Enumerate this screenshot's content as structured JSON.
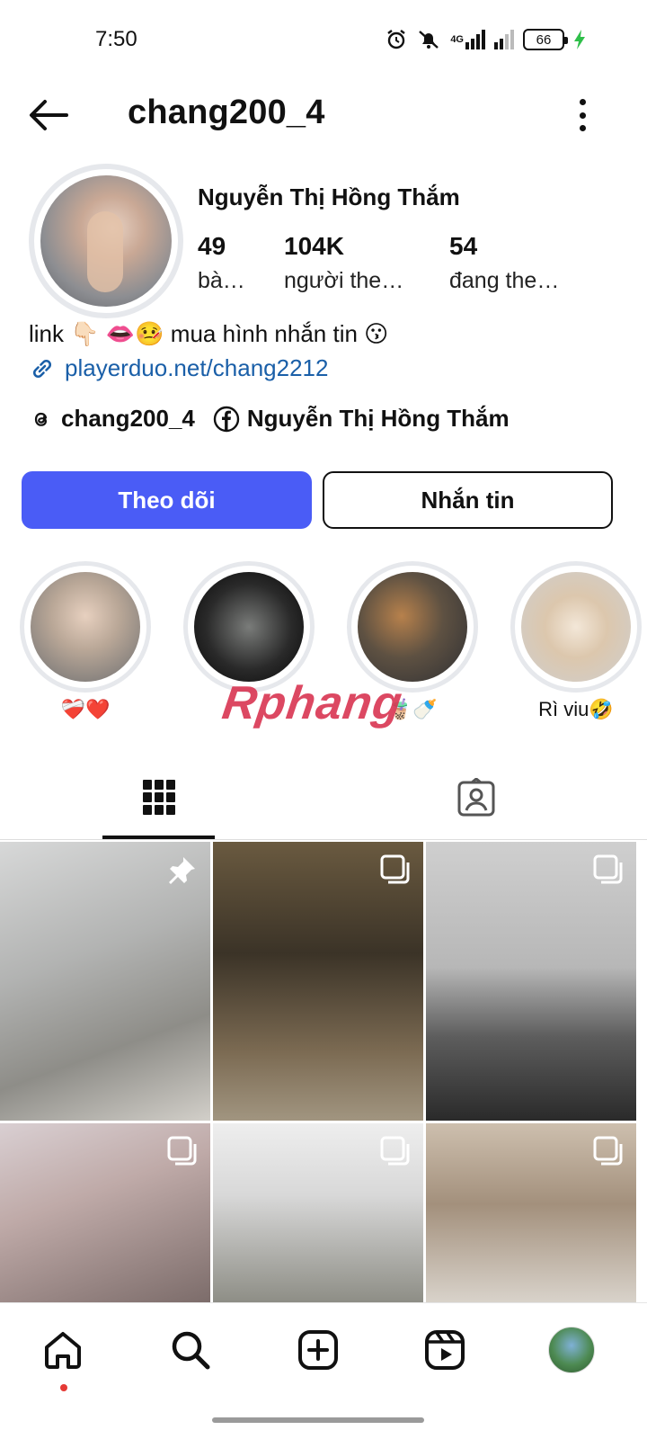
{
  "status_bar": {
    "time": "7:50",
    "network": "4G",
    "battery": "66"
  },
  "header": {
    "username": "chang200_4"
  },
  "profile": {
    "display_name": "Nguyễn Thị Hồng Thắm",
    "stats": {
      "posts": {
        "value": "49",
        "label": "bà…"
      },
      "followers": {
        "value": "104K",
        "label": "người the…"
      },
      "following": {
        "value": "54",
        "label": "đang the…"
      }
    },
    "bio": "link 👇🏻 👄🤒 mua hình nhắn tin 😗",
    "link": "playerduo.net/chang2212",
    "threads_handle": "chang200_4",
    "facebook_name": "Nguyễn Thị Hồng Thắm"
  },
  "actions": {
    "follow": "Theo dõi",
    "message": "Nhắn tin"
  },
  "highlights": [
    {
      "label": "❤️‍🩹❤️"
    },
    {
      "label": ""
    },
    {
      "label": "🧋🍼"
    },
    {
      "label": "Rì viu🤣"
    }
  ],
  "watermark": "Rphang",
  "tabs": [
    {
      "icon": "grid-icon",
      "active": true
    },
    {
      "icon": "tagged-icon",
      "active": false
    }
  ],
  "accent_color": "#4a5cf6",
  "link_color": "#1a5fa8",
  "bottom_nav": [
    "home-icon",
    "search-icon",
    "create-icon",
    "reels-icon",
    "profile-icon"
  ]
}
